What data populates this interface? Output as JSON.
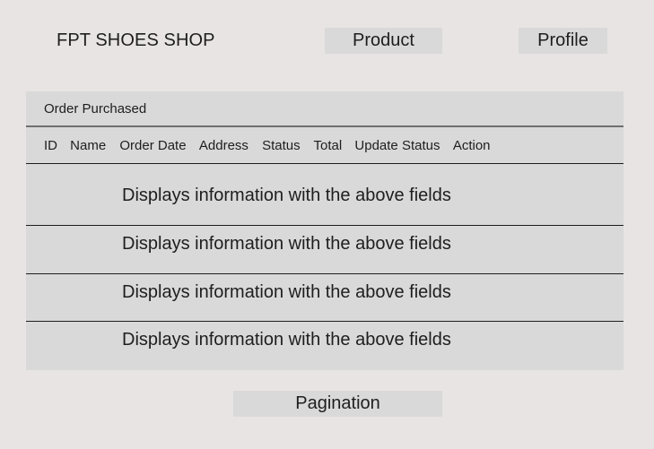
{
  "header": {
    "brand": "FPT SHOES SHOP",
    "nav": {
      "product": "Product",
      "profile": "Profile"
    }
  },
  "orders": {
    "title": "Order Purchased",
    "columns": [
      "ID",
      "Name",
      "Order Date",
      "Address",
      "Status",
      "Total",
      "Update Status",
      "Action"
    ],
    "rows": [
      "Displays information with the above fields",
      "Displays information with the above fields",
      "Displays information with the above fields",
      "Displays information with the above fields"
    ]
  },
  "pagination": {
    "label": "Pagination"
  }
}
